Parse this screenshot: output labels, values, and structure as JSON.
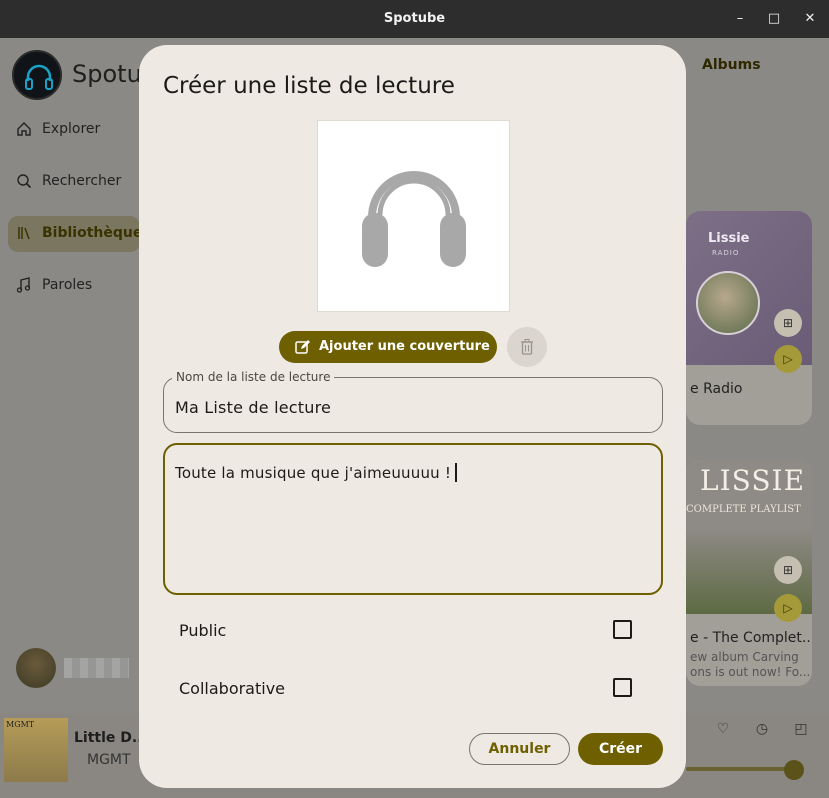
{
  "window": {
    "title": "Spotube",
    "minimize": "–",
    "maximize": "□",
    "close": "✕"
  },
  "sidebar": {
    "brand": "Spotube",
    "items": [
      {
        "label": "Explorer",
        "icon": "home-icon"
      },
      {
        "label": "Rechercher",
        "icon": "search-icon"
      },
      {
        "label": "Bibliothèque",
        "icon": "library-icon",
        "active": true
      },
      {
        "label": "Paroles",
        "icon": "music-note-icon"
      }
    ]
  },
  "background": {
    "tab_albums": "Albums",
    "card1": {
      "art_title": "Lissie",
      "art_sub": "RADIO",
      "label": "e Radio"
    },
    "card2": {
      "art_title": "LISSIE",
      "art_sub": "COMPLETE PLAYLIST",
      "label": "e - The Complet...",
      "desc_line1": "ew album Carving",
      "desc_line2": "ons is out now! Fo..."
    }
  },
  "player": {
    "track_title": "Little D...",
    "artist": "MGMT",
    "album_text": "MGMT"
  },
  "dialog": {
    "title": "Créer une liste de lecture",
    "add_cover_label": "Ajouter une couverture",
    "name_field": {
      "legend": "Nom de la liste de lecture",
      "value": "Ma Liste de lecture"
    },
    "description_field": {
      "value": "Toute la musique que j'aimeuuuuu !"
    },
    "public_label": "Public",
    "public_checked": false,
    "collaborative_label": "Collaborative",
    "collaborative_checked": false,
    "cancel_label": "Annuler",
    "create_label": "Créer"
  },
  "colors": {
    "accent": "#6e5f00",
    "dialog_bg": "#eee9e3",
    "titlebar": "#2d2d2d"
  }
}
